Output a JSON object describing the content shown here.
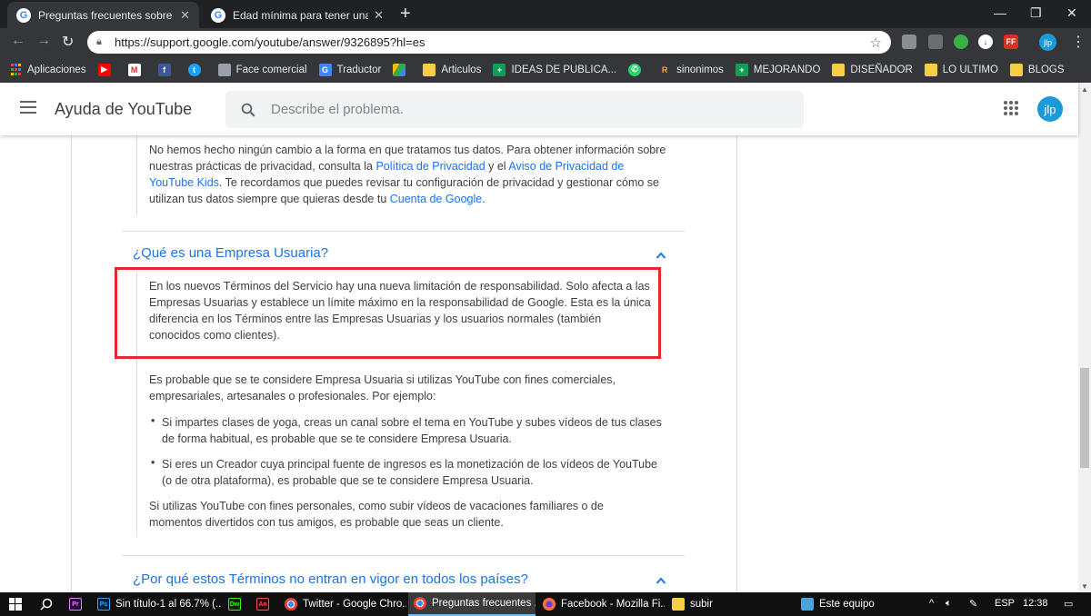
{
  "browser": {
    "tabs": [
      {
        "title": "Preguntas frecuentes sobre los Té",
        "active": true
      },
      {
        "title": "Edad mínima para tener una cue",
        "active": false
      }
    ],
    "url": "https://support.google.com/youtube/answer/9326895?hl=es",
    "profile_initials": "jlp",
    "extensions": [
      "shield-icon",
      "puzzle-icon",
      "green-extension-icon",
      "download-icon",
      "FF"
    ],
    "bookmarks": [
      {
        "label": "Aplicaciones",
        "icon": "apps-icon"
      },
      {
        "label": "",
        "icon": "youtube-icon"
      },
      {
        "label": "",
        "icon": "gmail-icon"
      },
      {
        "label": "",
        "icon": "facebook-icon"
      },
      {
        "label": "",
        "icon": "twitter-icon"
      },
      {
        "label": "Face comercial",
        "icon": "page-icon"
      },
      {
        "label": "Traductor",
        "icon": "translate-icon"
      },
      {
        "label": "",
        "icon": "drive-icon"
      },
      {
        "label": "Articulos",
        "icon": "folder-icon"
      },
      {
        "label": "IDEAS DE PUBLICA...",
        "icon": "sheets-icon"
      },
      {
        "label": "",
        "icon": "whatsapp-icon"
      },
      {
        "label": "sinonimos",
        "icon": "r-icon"
      },
      {
        "label": "MEJORANDO",
        "icon": "sheets-icon"
      },
      {
        "label": "DISEÑADOR",
        "icon": "folder-icon"
      },
      {
        "label": "LO ULTIMO",
        "icon": "folder-icon"
      },
      {
        "label": "BLOGS",
        "icon": "folder-icon"
      }
    ]
  },
  "header": {
    "title": "Ayuda de YouTube",
    "search_placeholder": "Describe el problema.",
    "avatar_initials": "jlp"
  },
  "content": {
    "privacy_paragraph": {
      "text1": "No hemos hecho ningún cambio a la forma en que tratamos tus datos. Para obtener información sobre nuestras prácticas de privacidad, consulta la ",
      "link1": "Política de Privacidad",
      "text2": " y el ",
      "link2": "Aviso de Privacidad de YouTube Kids",
      "text3": ". Te recordamos que puedes revisar tu configuración de privacidad y gestionar cómo se utilizan tus datos siempre que quieras desde tu ",
      "link3": "Cuenta de Google",
      "text4": "."
    },
    "question1": "¿Qué es una Empresa Usuaria?",
    "answer_highlight": "En los nuevos Términos del Servicio hay una nueva limitación de responsabilidad. Solo afecta a las Empresas Usuarias y establece un límite máximo en la responsabilidad de Google. Esta es la única diferencia en los Términos entre las Empresas Usuarias y los usuarios normales (también conocidos como clientes).",
    "answer_intro": "Es probable que se te considere Empresa Usuaria si utilizas YouTube con fines comerciales, empresariales, artesanales o profesionales. Por ejemplo:",
    "bullets": [
      "Si impartes clases de yoga, creas un canal sobre el tema en YouTube y subes vídeos de tus clases de forma habitual, es probable que se te considere Empresa Usuaria.",
      "Si eres un Creador cuya principal fuente de ingresos es la monetización de los vídeos de YouTube (o de otra plataforma), es probable que se te considere Empresa Usuaria."
    ],
    "answer_outro": "Si utilizas YouTube con fines personales, como subir vídeos de vacaciones familiares o de momentos divertidos con tus amigos, es probable que seas un cliente.",
    "question2": "¿Por qué estos Términos no entran en vigor en todos los países?"
  },
  "taskbar": {
    "items": [
      {
        "label": "Sin título-1 al 66.7% (...",
        "icon": "photoshop-icon",
        "active": false
      },
      {
        "label": "Twitter - Google Chro...",
        "icon": "chrome-icon",
        "active": false
      },
      {
        "label": "Preguntas frecuentes ...",
        "icon": "chrome-icon",
        "active": true
      },
      {
        "label": "Facebook - Mozilla Fi...",
        "icon": "firefox-icon",
        "active": false
      },
      {
        "label": "subir",
        "icon": "folder-icon",
        "active": false
      },
      {
        "label": "Este equipo",
        "icon": "computer-icon",
        "active": false
      }
    ],
    "language": "ESP",
    "time": "12:38"
  }
}
